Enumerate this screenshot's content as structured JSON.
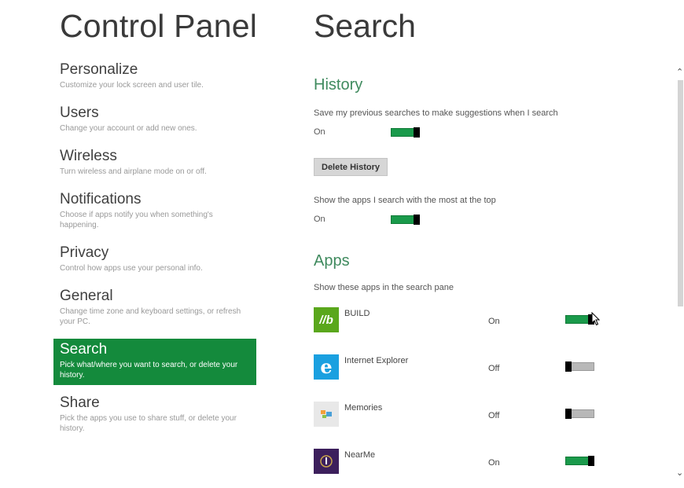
{
  "left_title": "Control Panel",
  "right_title": "Search",
  "nav": [
    {
      "label": "Personalize",
      "desc": "Customize your lock screen and user tile."
    },
    {
      "label": "Users",
      "desc": "Change your account or add new ones."
    },
    {
      "label": "Wireless",
      "desc": "Turn wireless and airplane mode on or off."
    },
    {
      "label": "Notifications",
      "desc": "Choose if apps notify you when something's happening."
    },
    {
      "label": "Privacy",
      "desc": "Control how apps use your personal info."
    },
    {
      "label": "General",
      "desc": "Change time zone and keyboard settings, or refresh your PC."
    },
    {
      "label": "Search",
      "desc": "Pick what/where you want to search, or delete your history."
    },
    {
      "label": "Share",
      "desc": "Pick the apps you use to share stuff, or delete your history."
    }
  ],
  "history": {
    "heading": "History",
    "save_label": "Save my previous searches to make suggestions when I search",
    "save_state": "On",
    "delete_button": "Delete History",
    "top_label": "Show the apps I search with the most at the top",
    "top_state": "On"
  },
  "apps": {
    "heading": "Apps",
    "subtitle": "Show these apps in the search pane",
    "list": [
      {
        "name": "BUILD",
        "state": "On",
        "icon_text": "//b",
        "icon_color": "#5aa71c"
      },
      {
        "name": "Internet Explorer",
        "state": "Off",
        "icon_text": "e",
        "icon_color": "#1aa0e0"
      },
      {
        "name": "Memories",
        "state": "Off",
        "icon_text": "",
        "icon_color": "#e8e8e8"
      },
      {
        "name": "NearMe",
        "state": "On",
        "icon_text": "",
        "icon_color": "#3c1f5c"
      }
    ]
  },
  "colors": {
    "accent": "#148a3c",
    "toggle_on": "#1a9a4b",
    "heading_green": "#3f8a5e"
  }
}
